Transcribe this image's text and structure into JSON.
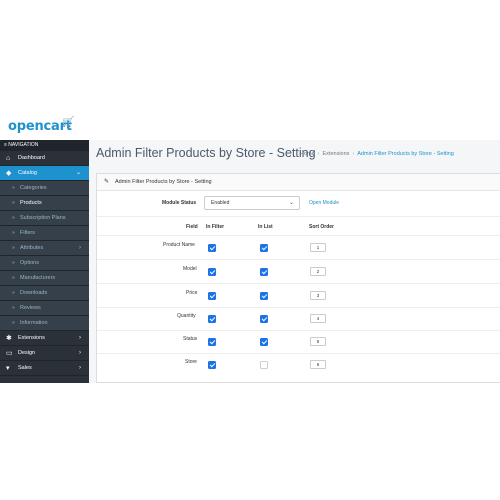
{
  "brand": {
    "logo_text": "opencart",
    "logo_cart": "🛒"
  },
  "nav": {
    "header": "≡ NAVIGATION",
    "items": [
      {
        "label": "Dashboard",
        "icon": "home-icon"
      },
      {
        "label": "Catalog",
        "icon": "tag-icon"
      },
      {
        "label": "Categories"
      },
      {
        "label": "Products"
      },
      {
        "label": "Subscription Plans"
      },
      {
        "label": "Filters"
      },
      {
        "label": "Attributes"
      },
      {
        "label": "Options"
      },
      {
        "label": "Manufacturers"
      },
      {
        "label": "Downloads"
      },
      {
        "label": "Reviews"
      },
      {
        "label": "Information"
      },
      {
        "label": "Extensions",
        "icon": "puzzle-icon"
      },
      {
        "label": "Design",
        "icon": "monitor-icon"
      },
      {
        "label": "Sales",
        "icon": "cart-icon"
      }
    ]
  },
  "page": {
    "title": "Admin Filter Products by Store - Setting",
    "breadcrumb": [
      "Home",
      "Extensions",
      "Admin Filter Products by Store - Setting"
    ]
  },
  "panel": {
    "heading": "Admin Filter Products by Store - Setting",
    "module_status_label": "Module Status",
    "module_status_value": "Enabled",
    "open_module_link": "Open Module",
    "columns": [
      "Field",
      "In Filter",
      "In List",
      "Sort Order"
    ],
    "rows": [
      {
        "field": "Product Name",
        "in_filter": true,
        "in_list": true,
        "sort": "1"
      },
      {
        "field": "Model",
        "in_filter": true,
        "in_list": true,
        "sort": "2"
      },
      {
        "field": "Price",
        "in_filter": true,
        "in_list": true,
        "sort": "3"
      },
      {
        "field": "Quantity",
        "in_filter": true,
        "in_list": true,
        "sort": "4"
      },
      {
        "field": "Status",
        "in_filter": true,
        "in_list": true,
        "sort": "5"
      },
      {
        "field": "Store",
        "in_filter": true,
        "in_list": false,
        "sort": "6"
      }
    ]
  },
  "colors": {
    "accent": "#1e91cf",
    "sidebar": "#2a3139",
    "checkbox": "#1a73e8"
  }
}
